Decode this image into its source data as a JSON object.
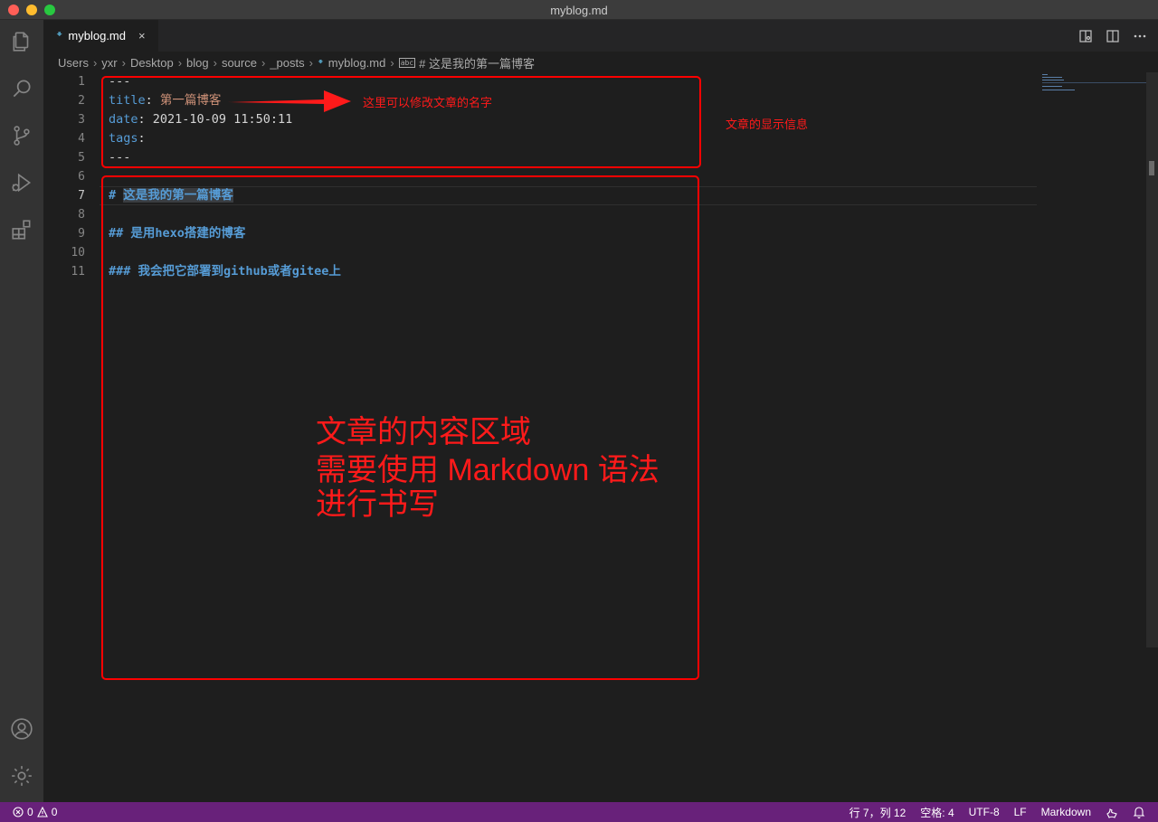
{
  "window": {
    "title": "myblog.md"
  },
  "tab": {
    "label": "myblog.md",
    "close": "×"
  },
  "breadcrumb": {
    "items": [
      "Users",
      "yxr",
      "Desktop",
      "blog",
      "source",
      "_posts"
    ],
    "file": "myblog.md",
    "symbol_icon": "abc",
    "symbol": "# 这是我的第一篇博客"
  },
  "editor": {
    "line_numbers": [
      "1",
      "2",
      "3",
      "4",
      "5",
      "6",
      "7",
      "8",
      "9",
      "10",
      "11"
    ],
    "active_line": "7",
    "front_matter": {
      "delim_open": "---",
      "title_key": "title",
      "title_value": "第一篇博客",
      "date_key": "date",
      "date_value": "2021-10-09 11:50:11",
      "tags_key": "tags",
      "delim_close": "---"
    },
    "h1_marker": "#",
    "h1_text": "这是我的第一篇博客",
    "h2": "## 是用hexo搭建的博客",
    "h3": "### 我会把它部署到github或者gitee上"
  },
  "annotations": {
    "arrow_note": "这里可以修改文章的名字",
    "info_note": "文章的显示信息",
    "content_note_1": "文章的内容区域",
    "content_note_2": "需要使用 Markdown 语法",
    "content_note_3": "进行书写",
    "color": "#ff0000"
  },
  "statusbar": {
    "errors": "0",
    "warnings": "0",
    "position": "行 7，列 12",
    "spaces": "空格: 4",
    "encoding": "UTF-8",
    "eol": "LF",
    "language": "Markdown",
    "background": "#68217a"
  },
  "icons": [
    "explorer-icon",
    "search-icon",
    "source-control-icon",
    "run-debug-icon",
    "extensions-icon",
    "account-icon",
    "settings-gear-icon",
    "split-editor-icon",
    "open-preview-icon",
    "more-actions-icon",
    "feedback-icon",
    "bell-icon"
  ]
}
